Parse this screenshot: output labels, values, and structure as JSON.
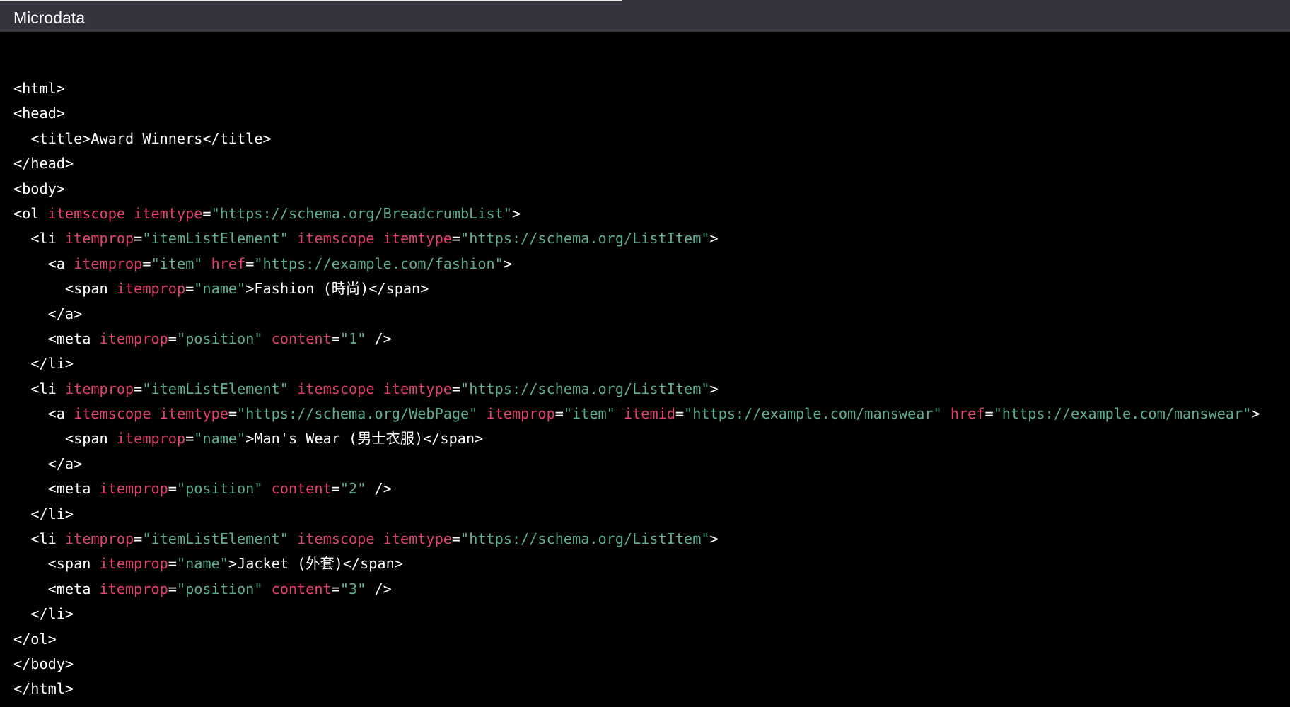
{
  "header": {
    "title": "Microdata"
  },
  "colors": {
    "header_bg": "#33343e",
    "code_bg": "#000000",
    "tag": "#ffffff",
    "attribute": "#e0426d",
    "string": "#5fae8f"
  },
  "code": {
    "lines": [
      [
        {
          "t": "tag",
          "v": "<html>"
        }
      ],
      [
        {
          "t": "tag",
          "v": "<head>"
        }
      ],
      [
        {
          "t": "txt",
          "v": "  "
        },
        {
          "t": "tag",
          "v": "<title>"
        },
        {
          "t": "txt",
          "v": "Award Winners"
        },
        {
          "t": "tag",
          "v": "</title>"
        }
      ],
      [
        {
          "t": "tag",
          "v": "</head>"
        }
      ],
      [
        {
          "t": "tag",
          "v": "<body>"
        }
      ],
      [
        {
          "t": "tag",
          "v": "<ol "
        },
        {
          "t": "attr",
          "v": "itemscope"
        },
        {
          "t": "txt",
          "v": " "
        },
        {
          "t": "attr",
          "v": "itemtype"
        },
        {
          "t": "txt",
          "v": "="
        },
        {
          "t": "str",
          "v": "\"https://schema.org/BreadcrumbList\""
        },
        {
          "t": "tag",
          "v": ">"
        }
      ],
      [
        {
          "t": "txt",
          "v": "  "
        },
        {
          "t": "tag",
          "v": "<li "
        },
        {
          "t": "attr",
          "v": "itemprop"
        },
        {
          "t": "txt",
          "v": "="
        },
        {
          "t": "str",
          "v": "\"itemListElement\""
        },
        {
          "t": "txt",
          "v": " "
        },
        {
          "t": "attr",
          "v": "itemscope"
        },
        {
          "t": "txt",
          "v": " "
        },
        {
          "t": "attr",
          "v": "itemtype"
        },
        {
          "t": "txt",
          "v": "="
        },
        {
          "t": "str",
          "v": "\"https://schema.org/ListItem\""
        },
        {
          "t": "tag",
          "v": ">"
        }
      ],
      [
        {
          "t": "txt",
          "v": "    "
        },
        {
          "t": "tag",
          "v": "<a "
        },
        {
          "t": "attr",
          "v": "itemprop"
        },
        {
          "t": "txt",
          "v": "="
        },
        {
          "t": "str",
          "v": "\"item\""
        },
        {
          "t": "txt",
          "v": " "
        },
        {
          "t": "attr",
          "v": "href"
        },
        {
          "t": "txt",
          "v": "="
        },
        {
          "t": "str",
          "v": "\"https://example.com/fashion\""
        },
        {
          "t": "tag",
          "v": ">"
        }
      ],
      [
        {
          "t": "txt",
          "v": "      "
        },
        {
          "t": "tag",
          "v": "<span "
        },
        {
          "t": "attr",
          "v": "itemprop"
        },
        {
          "t": "txt",
          "v": "="
        },
        {
          "t": "str",
          "v": "\"name\""
        },
        {
          "t": "tag",
          "v": ">"
        },
        {
          "t": "txt",
          "v": "Fashion (時尚)"
        },
        {
          "t": "tag",
          "v": "</span>"
        }
      ],
      [
        {
          "t": "txt",
          "v": "    "
        },
        {
          "t": "tag",
          "v": "</a>"
        }
      ],
      [
        {
          "t": "txt",
          "v": "    "
        },
        {
          "t": "tag",
          "v": "<meta "
        },
        {
          "t": "attr",
          "v": "itemprop"
        },
        {
          "t": "txt",
          "v": "="
        },
        {
          "t": "str",
          "v": "\"position\""
        },
        {
          "t": "txt",
          "v": " "
        },
        {
          "t": "attr",
          "v": "content"
        },
        {
          "t": "txt",
          "v": "="
        },
        {
          "t": "str",
          "v": "\"1\""
        },
        {
          "t": "tag",
          "v": " />"
        }
      ],
      [
        {
          "t": "txt",
          "v": "  "
        },
        {
          "t": "tag",
          "v": "</li>"
        }
      ],
      [
        {
          "t": "txt",
          "v": "  "
        },
        {
          "t": "tag",
          "v": "<li "
        },
        {
          "t": "attr",
          "v": "itemprop"
        },
        {
          "t": "txt",
          "v": "="
        },
        {
          "t": "str",
          "v": "\"itemListElement\""
        },
        {
          "t": "txt",
          "v": " "
        },
        {
          "t": "attr",
          "v": "itemscope"
        },
        {
          "t": "txt",
          "v": " "
        },
        {
          "t": "attr",
          "v": "itemtype"
        },
        {
          "t": "txt",
          "v": "="
        },
        {
          "t": "str",
          "v": "\"https://schema.org/ListItem\""
        },
        {
          "t": "tag",
          "v": ">"
        }
      ],
      [
        {
          "t": "txt",
          "v": "    "
        },
        {
          "t": "tag",
          "v": "<a "
        },
        {
          "t": "attr",
          "v": "itemscope"
        },
        {
          "t": "txt",
          "v": " "
        },
        {
          "t": "attr",
          "v": "itemtype"
        },
        {
          "t": "txt",
          "v": "="
        },
        {
          "t": "str",
          "v": "\"https://schema.org/WebPage\""
        },
        {
          "t": "txt",
          "v": " "
        },
        {
          "t": "attr",
          "v": "itemprop"
        },
        {
          "t": "txt",
          "v": "="
        },
        {
          "t": "str",
          "v": "\"item\""
        },
        {
          "t": "txt",
          "v": " "
        },
        {
          "t": "attr",
          "v": "itemid"
        },
        {
          "t": "txt",
          "v": "="
        },
        {
          "t": "str",
          "v": "\"https://example.com/manswear\""
        },
        {
          "t": "txt",
          "v": " "
        },
        {
          "t": "attr",
          "v": "href"
        },
        {
          "t": "txt",
          "v": "="
        },
        {
          "t": "str",
          "v": "\"https://example.com/manswear\""
        },
        {
          "t": "tag",
          "v": ">"
        }
      ],
      [
        {
          "t": "txt",
          "v": "      "
        },
        {
          "t": "tag",
          "v": "<span "
        },
        {
          "t": "attr",
          "v": "itemprop"
        },
        {
          "t": "txt",
          "v": "="
        },
        {
          "t": "str",
          "v": "\"name\""
        },
        {
          "t": "tag",
          "v": ">"
        },
        {
          "t": "txt",
          "v": "Man's Wear (男士衣服)"
        },
        {
          "t": "tag",
          "v": "</span>"
        }
      ],
      [
        {
          "t": "txt",
          "v": "    "
        },
        {
          "t": "tag",
          "v": "</a>"
        }
      ],
      [
        {
          "t": "txt",
          "v": "    "
        },
        {
          "t": "tag",
          "v": "<meta "
        },
        {
          "t": "attr",
          "v": "itemprop"
        },
        {
          "t": "txt",
          "v": "="
        },
        {
          "t": "str",
          "v": "\"position\""
        },
        {
          "t": "txt",
          "v": " "
        },
        {
          "t": "attr",
          "v": "content"
        },
        {
          "t": "txt",
          "v": "="
        },
        {
          "t": "str",
          "v": "\"2\""
        },
        {
          "t": "tag",
          "v": " />"
        }
      ],
      [
        {
          "t": "txt",
          "v": "  "
        },
        {
          "t": "tag",
          "v": "</li>"
        }
      ],
      [
        {
          "t": "txt",
          "v": "  "
        },
        {
          "t": "tag",
          "v": "<li "
        },
        {
          "t": "attr",
          "v": "itemprop"
        },
        {
          "t": "txt",
          "v": "="
        },
        {
          "t": "str",
          "v": "\"itemListElement\""
        },
        {
          "t": "txt",
          "v": " "
        },
        {
          "t": "attr",
          "v": "itemscope"
        },
        {
          "t": "txt",
          "v": " "
        },
        {
          "t": "attr",
          "v": "itemtype"
        },
        {
          "t": "txt",
          "v": "="
        },
        {
          "t": "str",
          "v": "\"https://schema.org/ListItem\""
        },
        {
          "t": "tag",
          "v": ">"
        }
      ],
      [
        {
          "t": "txt",
          "v": "    "
        },
        {
          "t": "tag",
          "v": "<span "
        },
        {
          "t": "attr",
          "v": "itemprop"
        },
        {
          "t": "txt",
          "v": "="
        },
        {
          "t": "str",
          "v": "\"name\""
        },
        {
          "t": "tag",
          "v": ">"
        },
        {
          "t": "txt",
          "v": "Jacket (外套)"
        },
        {
          "t": "tag",
          "v": "</span>"
        }
      ],
      [
        {
          "t": "txt",
          "v": "    "
        },
        {
          "t": "tag",
          "v": "<meta "
        },
        {
          "t": "attr",
          "v": "itemprop"
        },
        {
          "t": "txt",
          "v": "="
        },
        {
          "t": "str",
          "v": "\"position\""
        },
        {
          "t": "txt",
          "v": " "
        },
        {
          "t": "attr",
          "v": "content"
        },
        {
          "t": "txt",
          "v": "="
        },
        {
          "t": "str",
          "v": "\"3\""
        },
        {
          "t": "tag",
          "v": " />"
        }
      ],
      [
        {
          "t": "txt",
          "v": "  "
        },
        {
          "t": "tag",
          "v": "</li>"
        }
      ],
      [
        {
          "t": "tag",
          "v": "</ol>"
        }
      ],
      [
        {
          "t": "tag",
          "v": "</body>"
        }
      ],
      [
        {
          "t": "tag",
          "v": "</html>"
        }
      ]
    ]
  }
}
